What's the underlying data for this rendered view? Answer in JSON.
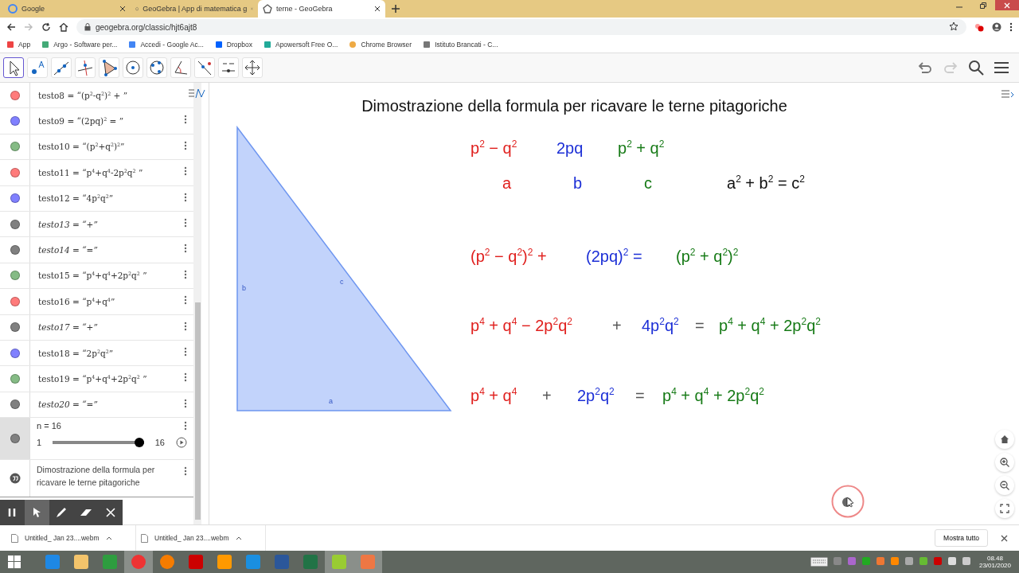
{
  "browser": {
    "tabs": [
      {
        "title": "Google",
        "selected": false
      },
      {
        "title": "GeoGebra | App di matematica g",
        "selected": false
      },
      {
        "title": "terne - GeoGebra",
        "selected": true
      }
    ],
    "address": "geogebra.org/classic/hjt6ajt8",
    "bookmarks": [
      "App",
      "Argo - Software per...",
      "Accedi - Google Ac...",
      "Dropbox",
      "Apowersoft Free O...",
      "Chrome Browser",
      "Istituto Brancati - C..."
    ]
  },
  "toolbar": {
    "tools": [
      {
        "selected": true
      },
      {
        "selected": false
      },
      {
        "selected": false
      },
      {
        "selected": false
      },
      {
        "selected": false
      },
      {
        "selected": false
      },
      {
        "selected": false
      },
      {
        "selected": false
      },
      {
        "selected": false
      },
      {
        "selected": false
      },
      {
        "selected": false
      }
    ]
  },
  "algebra": {
    "rows": [
      {
        "name": "testo8",
        "value": "= “(p$^{2}$-q$^{2}$)$^{2}$ + ”",
        "color": "#ff7b7b",
        "kind": "text",
        "menu": false
      },
      {
        "name": "testo9",
        "value": "= “(2pq)$^{2}$ = ”",
        "color": "#8080ff",
        "kind": "text",
        "menu": true
      },
      {
        "name": "testo10",
        "value": "= “(p$^{2}$+q$^{2}$)$^{2}$”",
        "color": "#85bb85",
        "kind": "text",
        "menu": true
      },
      {
        "name": "testo11",
        "value": "= “p$^{4}$+q$^{4}$-2p$^{2}$q$^{2}$ ”",
        "color": "#ff7b7b",
        "kind": "text",
        "menu": true
      },
      {
        "name": "testo12",
        "value": "= “4p$^{2}$q$^{2}$”",
        "color": "#8080ff",
        "kind": "text",
        "menu": true
      },
      {
        "name": "testo13",
        "value": "= “+”",
        "color": "#808080",
        "kind": "math",
        "menu": true
      },
      {
        "name": "testo14",
        "value": "= “=”",
        "color": "#808080",
        "kind": "math",
        "menu": true
      },
      {
        "name": "testo15",
        "value": "= “p$^{4}$+q$^{4}$+2p$^{2}$q$^{2}$ ”",
        "color": "#85bb85",
        "kind": "text",
        "menu": true
      },
      {
        "name": "testo16",
        "value": "= “p$^{4}$+q$^{4}$”",
        "color": "#ff7b7b",
        "kind": "text",
        "menu": true
      },
      {
        "name": "testo17",
        "value": "= “+”",
        "color": "#808080",
        "kind": "math",
        "menu": true
      },
      {
        "name": "testo18",
        "value": "= “2p$^{2}$q$^{2}$”",
        "color": "#8080ff",
        "kind": "text",
        "menu": true
      },
      {
        "name": "testo19",
        "value": "= “p$^{4}$+q$^{4}$+2p$^{2}$q$^{2}$ ”",
        "color": "#85bb85",
        "kind": "text",
        "menu": true
      },
      {
        "name": "testo20",
        "value": "= “=”",
        "color": "#808080",
        "kind": "math",
        "menu": true
      }
    ],
    "slider": {
      "label": "n = 16",
      "min": "1",
      "max": "16",
      "level": 1,
      "selected": true
    },
    "note": "Dimostrazione della formula per ricavare le terne pitagoriche"
  },
  "graphics": {
    "title": "Dimostrazione della formula per ricavare le terne pitagoriche",
    "triangle_labels": [
      "b",
      "c",
      "a"
    ],
    "math_rows": [
      [
        {
          "text": "p$^{2}$ − q$^{2}$",
          "color": "#e0201e"
        },
        {
          "text": "2pq",
          "color": "#1c2fd6"
        },
        {
          "text": "p$^{2}$ + q$^{2}$",
          "color": "#167a16"
        }
      ],
      [
        {
          "text": "a",
          "color": "#e0201e"
        },
        {
          "text": "b",
          "color": "#1c2fd6"
        },
        {
          "text": "c",
          "color": "#167a16"
        },
        {
          "text": "a$^{2}$ + b$^{2}$ = c$^{2}$",
          "color": "#111111"
        }
      ],
      [
        {
          "text": "(p$^{2}$ − q$^{2}$)$^{2}$ +",
          "color": "#e0201e"
        },
        {
          "text": "(2pq)$^{2}$ =",
          "color": "#1c2fd6"
        },
        {
          "text": "(p$^{2}$ + q$^{2}$)$^{2}$",
          "color": "#167a16"
        }
      ],
      [
        {
          "text": "p$^{4}$ + q$^{4}$ − 2p$^{2}$q$^{2}$",
          "color": "#e0201e"
        },
        {
          "text": "+",
          "color": "#555555"
        },
        {
          "text": "4p$^{2}$q$^{2}$",
          "color": "#1c2fd6"
        },
        {
          "text": "=",
          "color": "#555555"
        },
        {
          "text": "p$^{4}$ + q$^{4}$ + 2p$^{2}$q$^{2}$",
          "color": "#167a16"
        }
      ],
      [
        {
          "text": "p$^{4}$ + q$^{4}$",
          "color": "#e0201e"
        },
        {
          "text": "+",
          "color": "#555555"
        },
        {
          "text": "2p$^{2}$q$^{2}$",
          "color": "#1c2fd6"
        },
        {
          "text": "=",
          "color": "#555555"
        },
        {
          "text": "p$^{4}$ + q$^{4}$ + 2p$^{2}$q$^{2}$",
          "color": "#167a16"
        }
      ]
    ]
  },
  "downloads": {
    "items": [
      "Untitled_ Jan 23....webm",
      "Untitled_ Jan 23....webm"
    ],
    "show_all": "Mostra tutto"
  },
  "taskbar": {
    "time": "08.48",
    "date": "23/01/2020"
  }
}
